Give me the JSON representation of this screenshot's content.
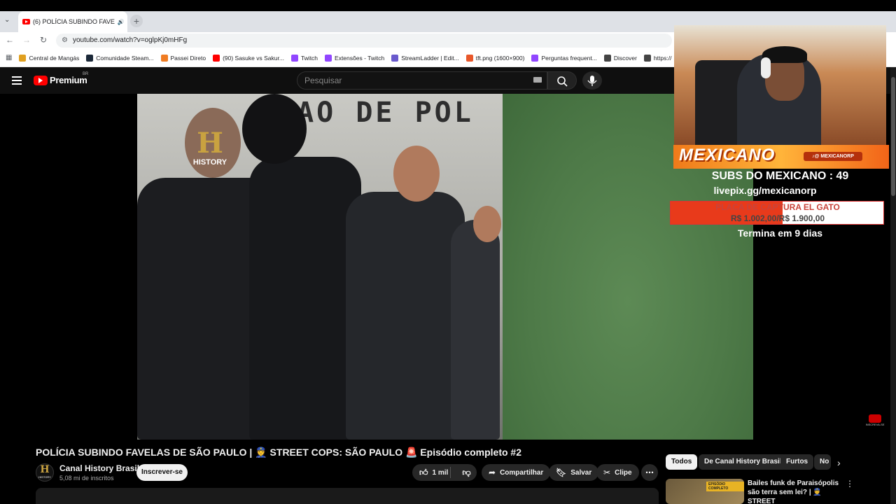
{
  "browser": {
    "tab_title": "(6) POLÍCIA SUBINDO FAVE",
    "audio_icon": "speaker-icon",
    "url": "youtube.com/watch?v=oglpKj0mHFg",
    "bookmarks": [
      {
        "label": "Central de Mangás",
        "color": "#e0a020"
      },
      {
        "label": "Comunidade Steam...",
        "color": "#1b2838"
      },
      {
        "label": "Passei Direto",
        "color": "#f07c22"
      },
      {
        "label": "(90) Sasuke vs Sakur...",
        "color": "#ff0000"
      },
      {
        "label": "Twitch",
        "color": "#9146ff"
      },
      {
        "label": "Extensões - Twitch",
        "color": "#9146ff"
      },
      {
        "label": "StreamLadder | Edit...",
        "color": "#6a5acd"
      },
      {
        "label": "tft.png (1600×900)",
        "color": "#e8572a"
      },
      {
        "label": "Perguntas frequent...",
        "color": "#9146ff"
      },
      {
        "label": "Discover",
        "color": "#444444"
      },
      {
        "label": "https://",
        "color": "#444444"
      }
    ]
  },
  "youtube": {
    "logo_text": "Premium",
    "region": "BR",
    "search_placeholder": "Pesquisar"
  },
  "video": {
    "wall_text": "TAO DE POL",
    "history_letter": "H",
    "history_text": "HISTORY",
    "title": "POLÍCIA SUBINDO FAVELAS DE SÃO PAULO | 👮 STREET COPS: SÃO PAULO 🚨 Episódio completo #2",
    "channel_name": "Canal History Brasil",
    "channel_subs": "5,08 mi de inscritos",
    "subscribe_label": "Inscrever-se",
    "likes": "1 mil",
    "share_label": "Compartilhar",
    "save_label": "Salvar",
    "clip_label": "Clipe"
  },
  "stream_overlay": {
    "name": "MEXICANO",
    "handle": "♪@ MEXICANORP",
    "subs_text": "SUBS DO MEXICANO : 49",
    "url": "livepix.gg/mexicanorp",
    "goal_title": "PLACA DE CAPTURA EL GATO",
    "goal_values": "R$ 1.002,00/R$ 1.900,00",
    "goal_progress": 0.527,
    "ends_text": "Termina em 9 dias"
  },
  "chips": [
    "Todos",
    "De Canal History Brasil",
    "Furtos",
    "No"
  ],
  "recommendation": {
    "thumb_label": "EPISÓDIO COMPLETO",
    "title": "Bailes funk de Paraisópolis são terra sem lei? | 👮 STREET"
  },
  "watermark_text": "INSCREVA-SE"
}
